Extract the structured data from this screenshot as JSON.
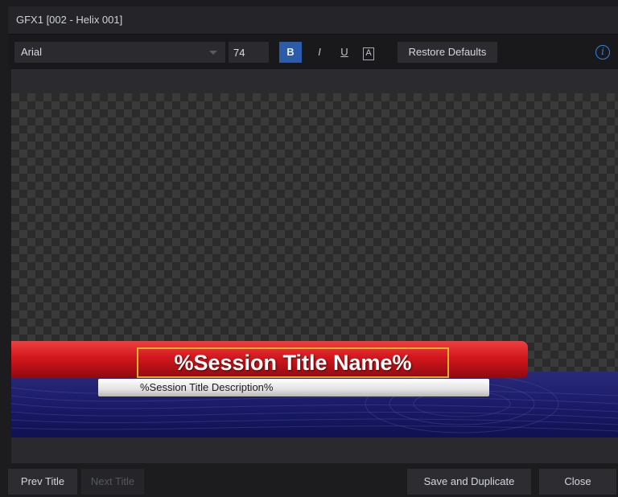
{
  "window": {
    "title": "GFX1  [002 - Helix 001]"
  },
  "toolbar": {
    "font": "Arial",
    "size": "74",
    "bold_label": "B",
    "italic_label": "I",
    "underline_label": "U",
    "background_label": "A",
    "restore_label": "Restore Defaults",
    "info_label": "i"
  },
  "preview": {
    "title_text": "%Session Title Name%",
    "description_text": "%Session Title Description%"
  },
  "footer": {
    "prev_label": "Prev Title",
    "next_label": "Next Title",
    "save_duplicate_label": "Save and Duplicate",
    "close_label": "Close"
  },
  "colors": {
    "accent_blue": "#2a5caa",
    "title_red": "#d1171d",
    "band_blue": "#1c1c6b",
    "selection_gold": "#d8b02a"
  }
}
